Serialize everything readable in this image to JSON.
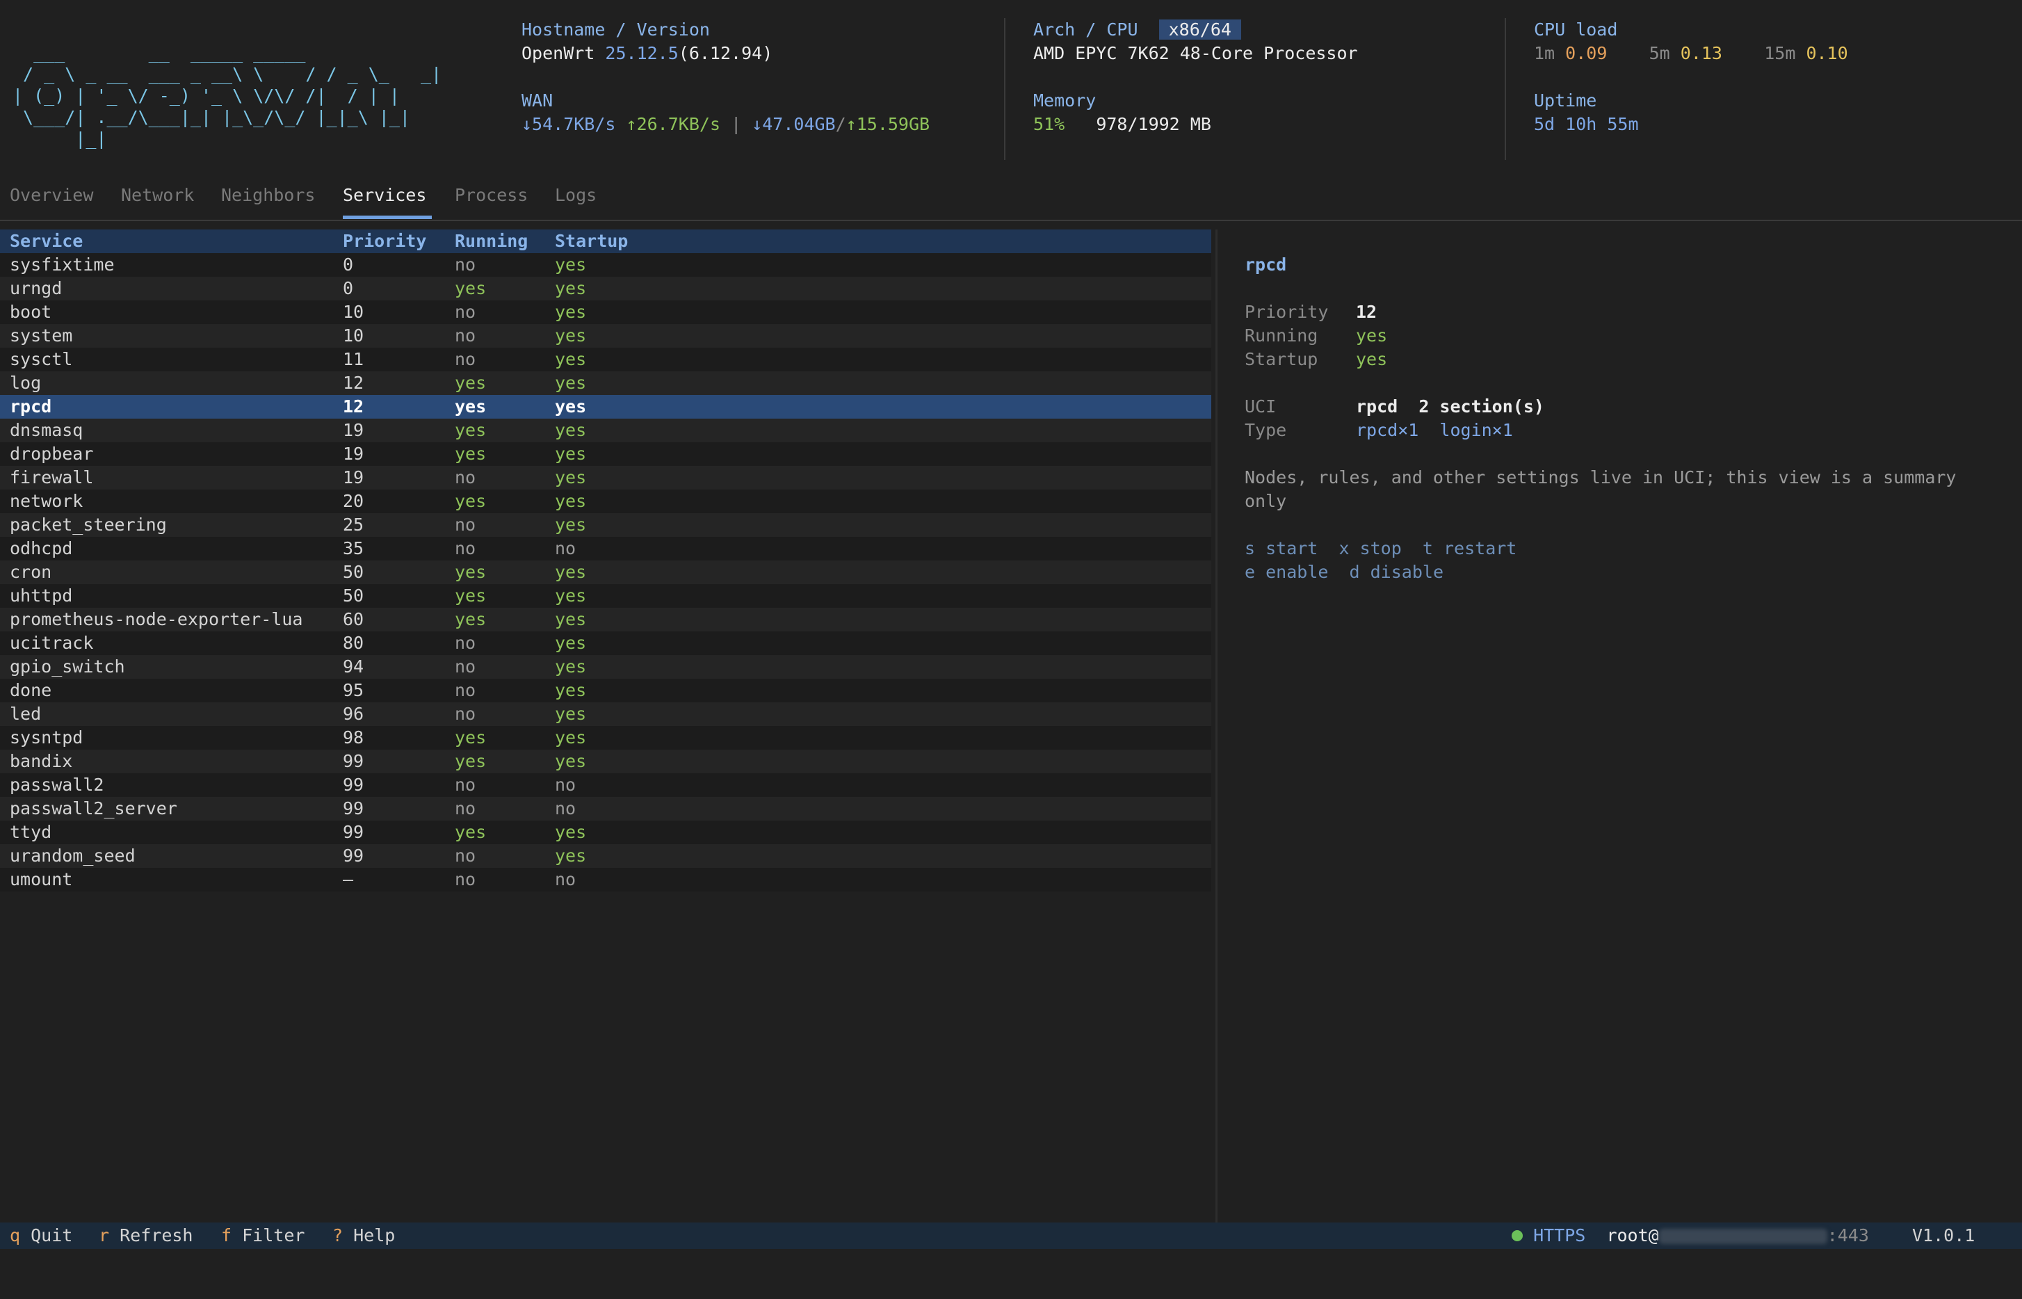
{
  "logo_ascii": "  ___        __  _____ _____\n / _ \\ _ __  ___ _ __\\ \\    / / _ \\_   _|\n| (_) | '_ \\/ -_) '_ \\ \\/\\/ /|  / | |\n \\___/| .__/\\___|_| |_\\_/\\_/ |_|_\\ |_|\n      |_|",
  "header": {
    "hostname_label": "Hostname / Version",
    "hostname": "OpenWrt",
    "version": "25.12.5",
    "kernel": "(6.12.94)",
    "wan_label": "WAN",
    "wan_rx_rate": "↓54.7KB/s",
    "wan_tx_rate": "↑26.7KB/s",
    "wan_sep": "|",
    "wan_rx_total": "↓47.04GB",
    "wan_slash": "/",
    "wan_tx_total": "↑15.59GB",
    "arch_label": "Arch / CPU",
    "arch_badge": "x86/64",
    "cpu_model": "AMD EPYC 7K62 48-Core Processor",
    "memory_label": "Memory",
    "memory_percent": "51%",
    "memory_usage": "978/1992 MB",
    "load_label": "CPU load",
    "load_1m_label": "1m",
    "load_1m": "0.09",
    "load_5m_label": "5m",
    "load_5m": "0.13",
    "load_15m_label": "15m",
    "load_15m": "0.10",
    "uptime_label": "Uptime",
    "uptime": "5d 10h 55m"
  },
  "tabs": [
    "Overview",
    "Network",
    "Neighbors",
    "Services",
    "Process",
    "Logs"
  ],
  "active_tab": "Services",
  "table": {
    "headers": [
      "Service",
      "Priority",
      "Running",
      "Startup"
    ],
    "rows": [
      [
        "sysfixtime",
        "0",
        "no",
        "yes"
      ],
      [
        "urngd",
        "0",
        "yes",
        "yes"
      ],
      [
        "boot",
        "10",
        "no",
        "yes"
      ],
      [
        "system",
        "10",
        "no",
        "yes"
      ],
      [
        "sysctl",
        "11",
        "no",
        "yes"
      ],
      [
        "log",
        "12",
        "yes",
        "yes"
      ],
      [
        "rpcd",
        "12",
        "yes",
        "yes"
      ],
      [
        "dnsmasq",
        "19",
        "yes",
        "yes"
      ],
      [
        "dropbear",
        "19",
        "yes",
        "yes"
      ],
      [
        "firewall",
        "19",
        "no",
        "yes"
      ],
      [
        "network",
        "20",
        "yes",
        "yes"
      ],
      [
        "packet_steering",
        "25",
        "no",
        "yes"
      ],
      [
        "odhcpd",
        "35",
        "no",
        "no"
      ],
      [
        "cron",
        "50",
        "yes",
        "yes"
      ],
      [
        "uhttpd",
        "50",
        "yes",
        "yes"
      ],
      [
        "prometheus-node-exporter-lua",
        "60",
        "yes",
        "yes"
      ],
      [
        "ucitrack",
        "80",
        "no",
        "yes"
      ],
      [
        "gpio_switch",
        "94",
        "no",
        "yes"
      ],
      [
        "done",
        "95",
        "no",
        "yes"
      ],
      [
        "led",
        "96",
        "no",
        "yes"
      ],
      [
        "sysntpd",
        "98",
        "yes",
        "yes"
      ],
      [
        "bandix",
        "99",
        "yes",
        "yes"
      ],
      [
        "passwall2",
        "99",
        "no",
        "no"
      ],
      [
        "passwall2_server",
        "99",
        "no",
        "no"
      ],
      [
        "ttyd",
        "99",
        "yes",
        "yes"
      ],
      [
        "urandom_seed",
        "99",
        "no",
        "yes"
      ],
      [
        "umount",
        "—",
        "no",
        "no"
      ]
    ],
    "selected_index": 6
  },
  "detail": {
    "name": "rpcd",
    "priority_label": "Priority",
    "priority": "12",
    "running_label": "Running",
    "running": "yes",
    "startup_label": "Startup",
    "startup": "yes",
    "uci_label": "UCI",
    "uci_name": "rpcd",
    "uci_sections": "2 section(s)",
    "type_label": "Type",
    "type_1": "rpcd×1",
    "type_2": "login×1",
    "note_line1": "Nodes, rules, and other settings live in UCI; this view is a summary",
    "note_line2": "only",
    "hint_start": "s start",
    "hint_stop": "x stop",
    "hint_restart": "t restart",
    "hint_enable": "e enable",
    "hint_disable": "d disable"
  },
  "statusbar": {
    "quit_key": "q",
    "quit_label": "Quit",
    "refresh_key": "r",
    "refresh_label": "Refresh",
    "filter_key": "f",
    "filter_label": "Filter",
    "help_key": "?",
    "help_label": "Help",
    "protocol": "HTTPS",
    "user": "root@",
    "port": ":443",
    "version": "V1.0.1",
    "github_icon": "github-icon"
  },
  "colors": {
    "accent": "#8ab4e8",
    "selected_row": "#2a4a78",
    "yes": "#8fc35a",
    "key": "#e6a15c"
  }
}
